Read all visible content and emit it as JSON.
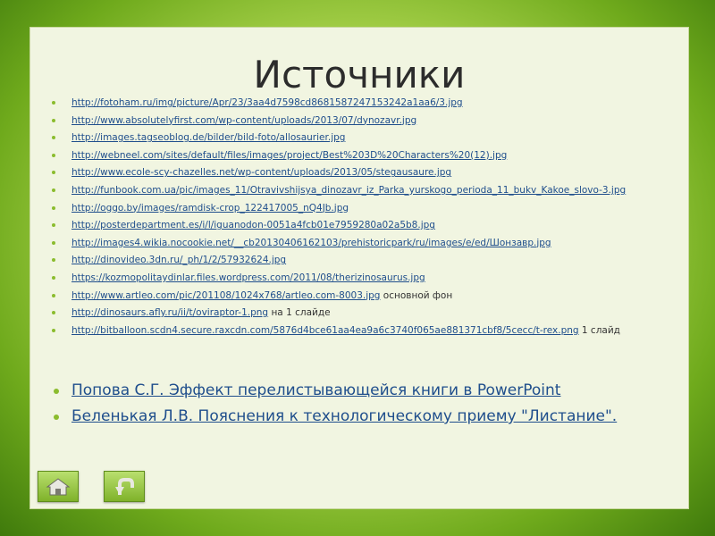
{
  "title": "Источники",
  "links": [
    {
      "url": "http://fotoham.ru/img/picture/Apr/23/3aa4d7598cd8681587247153242a1aa6/3.jpg",
      "note": ""
    },
    {
      "url": "http://www.absolutelyfirst.com/wp-content/uploads/2013/07/dynozavr.jpg",
      "note": ""
    },
    {
      "url": "http://images.tagseoblog.de/bilder/bild-foto/allosaurier.jpg",
      "note": ""
    },
    {
      "url": "http://webneel.com/sites/default/files/images/project/Best%203D%20Characters%20(12).jpg",
      "note": ""
    },
    {
      "url": "http://www.ecole-scy-chazelles.net/wp-content/uploads/2013/05/stegausaure.jpg",
      "note": ""
    },
    {
      "url": "http://funbook.com.ua/pic/images_11/Otravivshijsya_dinozavr_iz_Parka_yurskogo_perioda_11_bukv_Kakoe_slovo-3.jpg",
      "note": ""
    },
    {
      "url": "http://oggo.by/images/ramdisk-crop_122417005_nQ4Jb.jpg",
      "note": ""
    },
    {
      "url": "http://posterdepartment.es/i/l/iguanodon-0051a4fcb01e7959280a02a5b8.jpg",
      "note": ""
    },
    {
      "url": "http://images4.wikia.nocookie.net/__cb20130406162103/prehistoricpark/ru/images/e/ed/Шонзавр.jpg",
      "note": ""
    },
    {
      "url": "http://dinovideo.3dn.ru/_ph/1/2/57932624.jpg",
      "note": ""
    },
    {
      "url": "https://kozmopolitaydinlar.files.wordpress.com/2011/08/therizinosaurus.jpg",
      "note": ""
    },
    {
      "url": "http://www.artleo.com/pic/201108/1024x768/artleo.com-8003.jpg",
      "note": " основной фон"
    },
    {
      "url": "http://dinosaurs.afly.ru/ii/t/oviraptor-1.png",
      "note": " на 1 слайде"
    },
    {
      "url": "http://bitballoon.scdn4.secure.raxcdn.com/5876d4bce61aa4ea9a6c3740f065ae881371cbf8/5cecc/t-rex.png",
      "note": " 1 слайд"
    }
  ],
  "references": [
    {
      "text": "Попова С.Г. Эффект перелистывающейся книги в PowerPoint"
    },
    {
      "text": " Беленькая Л.В. Пояснения к технологическому приему \"Листание\"."
    }
  ],
  "icons": {
    "home": "home-icon",
    "back": "return-arrow-icon"
  },
  "colors": {
    "link": "#1f4e8c",
    "accent": "#8bbc2e",
    "panel": "#f1f5e1"
  }
}
